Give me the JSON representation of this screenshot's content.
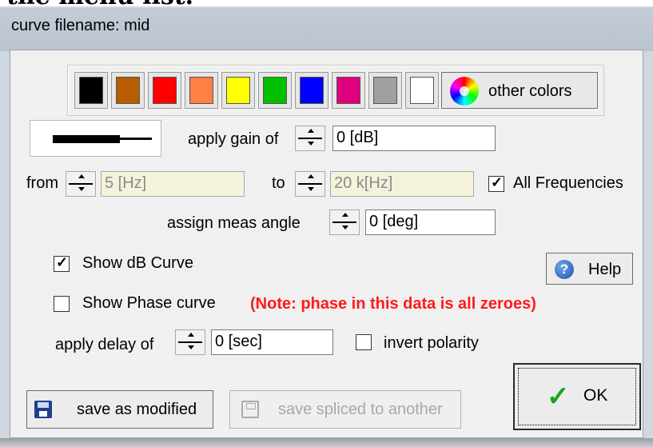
{
  "backdrop": {
    "heading_fragment": "the menu list."
  },
  "window": {
    "title": "curve filename: mid"
  },
  "palette": {
    "swatches": [
      {
        "name": "black",
        "color": "#000000"
      },
      {
        "name": "brown",
        "color": "#b85c00"
      },
      {
        "name": "red",
        "color": "#ff0000"
      },
      {
        "name": "orange",
        "color": "#ff8040"
      },
      {
        "name": "yellow",
        "color": "#ffff00"
      },
      {
        "name": "green",
        "color": "#00c000"
      },
      {
        "name": "blue",
        "color": "#0000ff"
      },
      {
        "name": "magenta",
        "color": "#e0007f"
      },
      {
        "name": "gray",
        "color": "#a0a0a0"
      },
      {
        "name": "white",
        "color": "#ffffff"
      }
    ],
    "other_colors_label": "other colors"
  },
  "gain": {
    "label": "apply gain of",
    "value": "0 [dB]"
  },
  "range": {
    "from_label": "from",
    "from_value": "5 [Hz]",
    "to_label": "to",
    "to_value": "20 k[Hz]",
    "all_frequencies_label": "All Frequencies",
    "all_frequencies_checked": true
  },
  "angle": {
    "label": "assign meas angle",
    "value": "0 [deg]"
  },
  "show_db": {
    "label": "Show dB Curve",
    "checked": true
  },
  "show_phase": {
    "label": "Show Phase curve",
    "checked": false
  },
  "note": "(Note: phase in this data is all zeroes)",
  "help_label": "Help",
  "delay": {
    "label": "apply delay of",
    "value": "0 [sec]"
  },
  "invert": {
    "label": "invert polarity",
    "checked": false
  },
  "ok_label": "OK",
  "save_modified_label": "save as modified",
  "save_spliced_label": "save spliced to another"
}
